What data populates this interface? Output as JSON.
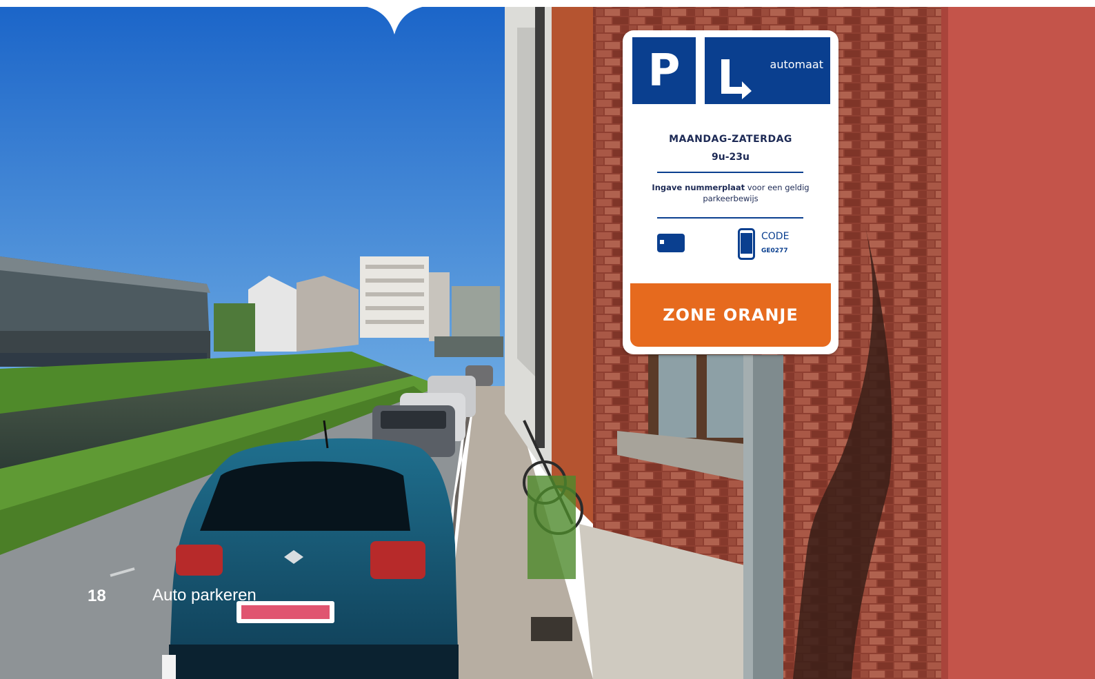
{
  "page": {
    "number": "18",
    "section_title": "Auto parkeren"
  },
  "sign": {
    "parking_letter": "P",
    "automaat_label": "automaat",
    "days": "MAANDAG-ZATERDAG",
    "hours": "9u-23u",
    "instruction_bold": "Ingave nummerplaat",
    "instruction_rest": " voor een geldig parkeerbewijs",
    "code_label": "CODE",
    "code_value": "GE0277",
    "zone": "ZONE ORANJE"
  },
  "colors": {
    "sign_blue": "#0a3f8f",
    "zone_orange": "#e66a1e",
    "car_blue": "#1b5a78",
    "brick": "#9c4a3a",
    "sky": "#2f7fcf"
  },
  "icons": [
    "card-icon",
    "phone-icon",
    "parking-sign",
    "car",
    "bicycles"
  ]
}
